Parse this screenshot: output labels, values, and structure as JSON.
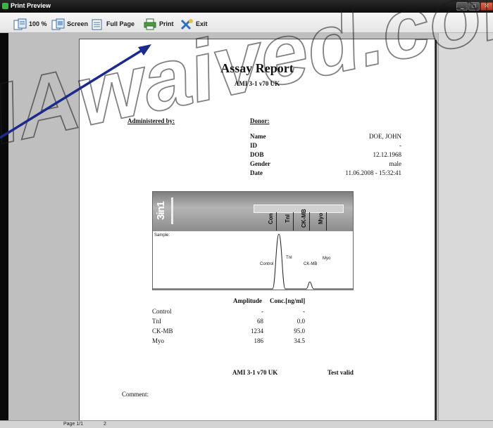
{
  "window": {
    "title": "Print Preview"
  },
  "toolbar": {
    "buttons": [
      {
        "label": "100 %",
        "icon": "page-100-icon"
      },
      {
        "label": "Screen",
        "icon": "page-screen-icon"
      },
      {
        "label": "Full Page",
        "icon": "page-full-icon"
      },
      {
        "label": "Print",
        "icon": "printer-icon"
      },
      {
        "label": "Exit",
        "icon": "exit-icon"
      }
    ]
  },
  "report": {
    "title": "Assay Report",
    "subtitle": "AMI 3-1 v70 UK",
    "administered_label": "Administered by:",
    "donor_label": "Donor:",
    "donor": [
      {
        "key": "Name",
        "value": "DOE, JOHN"
      },
      {
        "key": "ID",
        "value": "-"
      },
      {
        "key": "DOB",
        "value": "12.12.1968"
      },
      {
        "key": "Gender",
        "value": "male"
      },
      {
        "key": "Date",
        "value": "11.06.2008 - 15:32:41"
      }
    ],
    "strip": {
      "brand": "3in1",
      "markers": [
        "Con",
        "TnI",
        "CK-MB",
        "Myo"
      ],
      "sample_label": "Sample:",
      "peaks": [
        "Control",
        "TnI",
        "CK-MB",
        "Myo"
      ]
    },
    "table": {
      "col_amplitude": "Amplitude",
      "col_conc": "Conc.[ng/ml]",
      "rows": [
        {
          "name": "Control",
          "amplitude": "-",
          "conc": "-"
        },
        {
          "name": "TnI",
          "amplitude": "68",
          "conc": "0.0"
        },
        {
          "name": "CK-MB",
          "amplitude": "1234",
          "conc": "95.0"
        },
        {
          "name": "Myo",
          "amplitude": "186",
          "conc": "34.5"
        }
      ]
    },
    "footer_model": "AMI 3-1 v70 UK",
    "footer_valid": "Test valid",
    "comment_label": "Comment:"
  },
  "status": {
    "page": "Page 1/1",
    "zoom": "2"
  },
  "watermark": {
    "text": "IAwaived.com"
  },
  "colors": {
    "watermark": "#1a1a1a",
    "arrow": "#1c2a8c",
    "close_button": "#c8452c"
  }
}
